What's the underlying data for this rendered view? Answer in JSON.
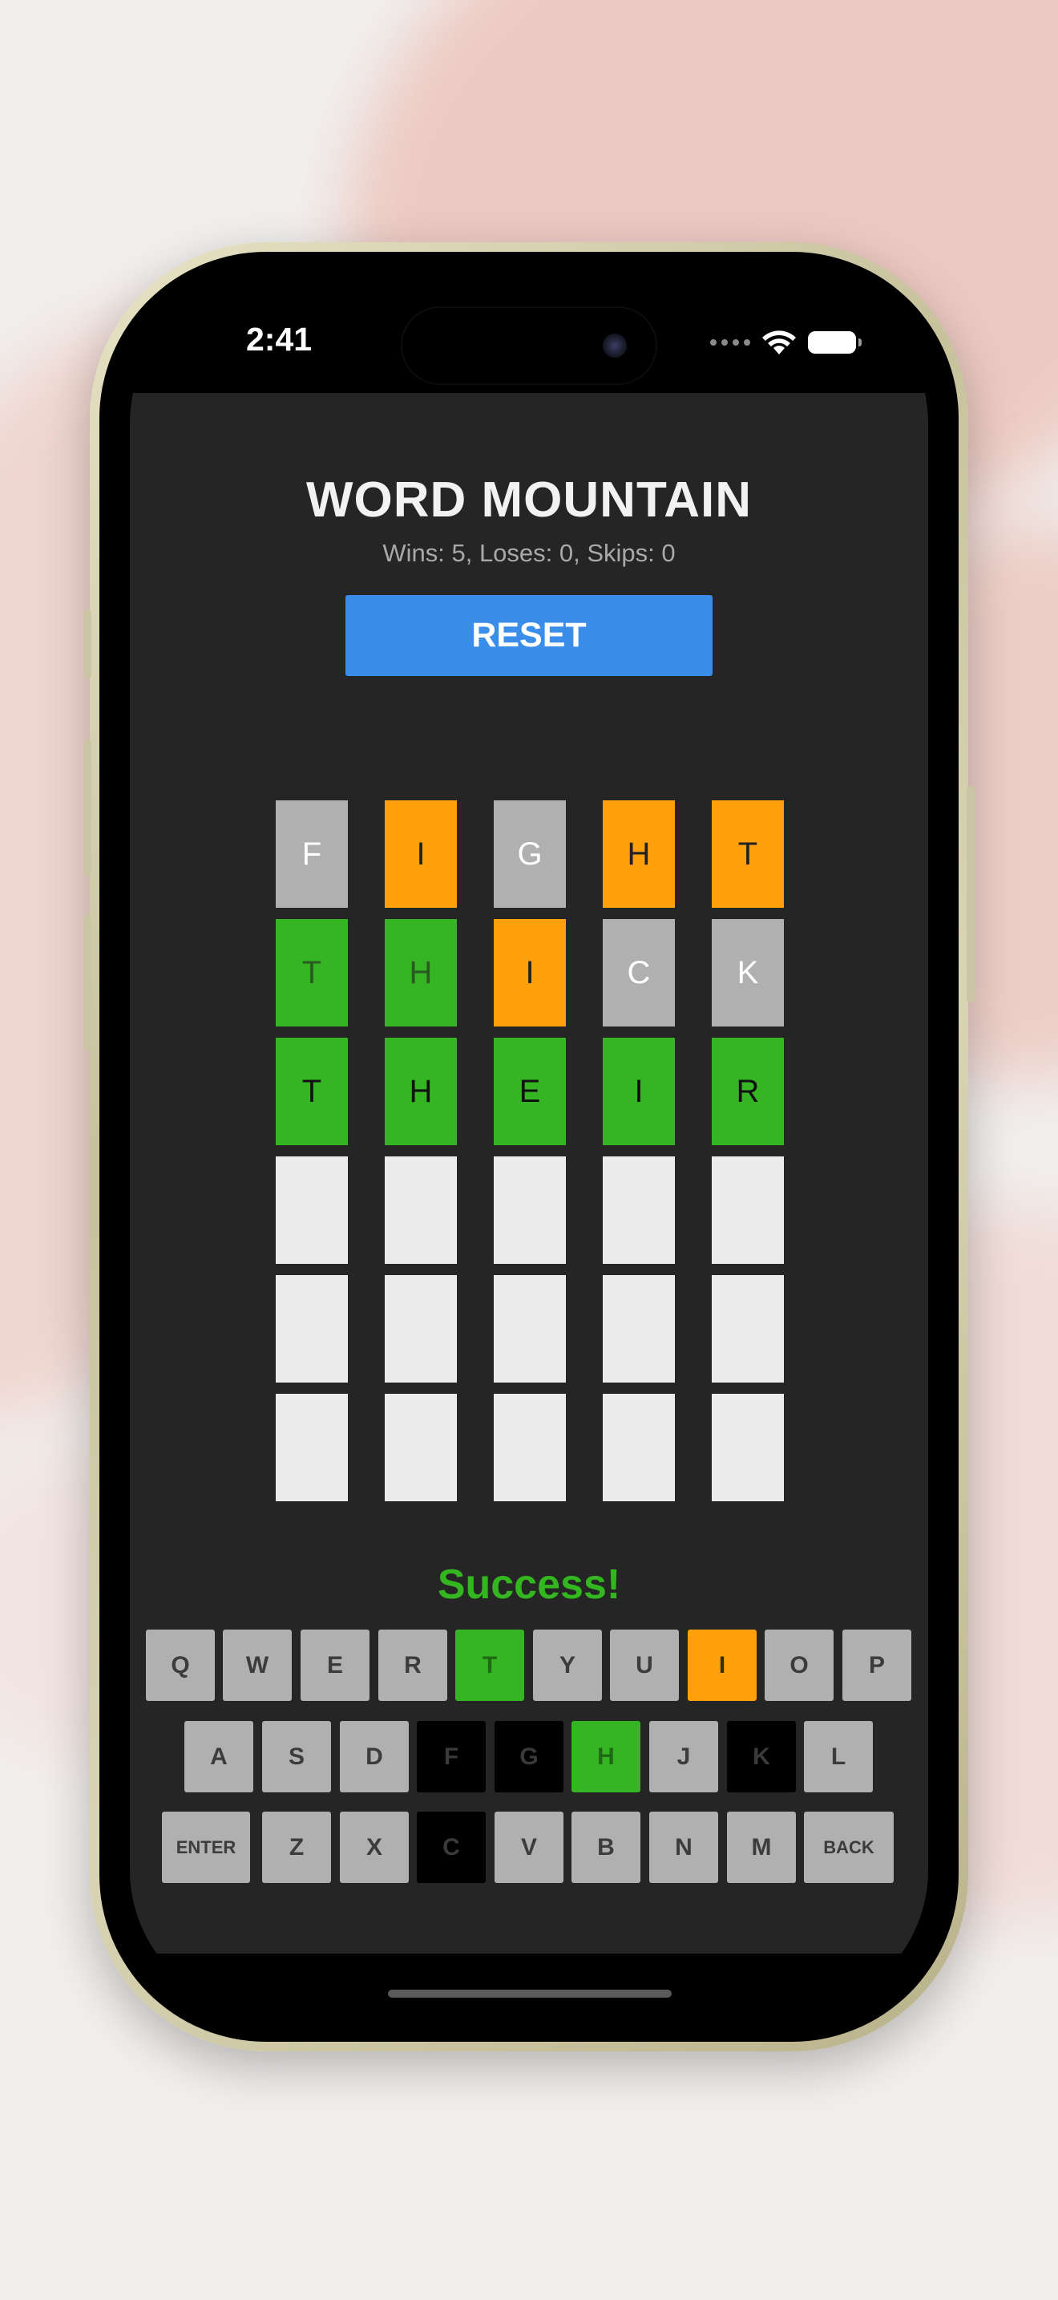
{
  "status_bar": {
    "time": "2:41"
  },
  "app": {
    "title": "WORD MOUNTAIN",
    "stats": "Wins: 5, Loses: 0, Skips: 0",
    "reset_label": "RESET",
    "message": "Success!"
  },
  "colors": {
    "green": "#36b524",
    "orange": "#ffa00c",
    "gray": "#b0b0b0",
    "empty": "#ececec",
    "absent": "#000000",
    "reset": "#3a8de8"
  },
  "board": [
    [
      {
        "letter": "F",
        "state": "gray"
      },
      {
        "letter": "I",
        "state": "orange"
      },
      {
        "letter": "G",
        "state": "gray"
      },
      {
        "letter": "H",
        "state": "orange"
      },
      {
        "letter": "T",
        "state": "orange"
      }
    ],
    [
      {
        "letter": "T",
        "state": "green"
      },
      {
        "letter": "H",
        "state": "green"
      },
      {
        "letter": "I",
        "state": "orange"
      },
      {
        "letter": "C",
        "state": "gray"
      },
      {
        "letter": "K",
        "state": "gray"
      }
    ],
    [
      {
        "letter": "T",
        "state": "green"
      },
      {
        "letter": "H",
        "state": "green"
      },
      {
        "letter": "E",
        "state": "green"
      },
      {
        "letter": "I",
        "state": "green"
      },
      {
        "letter": "R",
        "state": "green"
      }
    ],
    [
      {
        "letter": "",
        "state": "empty"
      },
      {
        "letter": "",
        "state": "empty"
      },
      {
        "letter": "",
        "state": "empty"
      },
      {
        "letter": "",
        "state": "empty"
      },
      {
        "letter": "",
        "state": "empty"
      }
    ],
    [
      {
        "letter": "",
        "state": "empty"
      },
      {
        "letter": "",
        "state": "empty"
      },
      {
        "letter": "",
        "state": "empty"
      },
      {
        "letter": "",
        "state": "empty"
      },
      {
        "letter": "",
        "state": "empty"
      }
    ],
    [
      {
        "letter": "",
        "state": "empty"
      },
      {
        "letter": "",
        "state": "empty"
      },
      {
        "letter": "",
        "state": "empty"
      },
      {
        "letter": "",
        "state": "empty"
      },
      {
        "letter": "",
        "state": "empty"
      }
    ]
  ],
  "keyboard": [
    [
      {
        "label": "Q",
        "state": "gray"
      },
      {
        "label": "W",
        "state": "gray"
      },
      {
        "label": "E",
        "state": "gray"
      },
      {
        "label": "R",
        "state": "gray"
      },
      {
        "label": "T",
        "state": "green"
      },
      {
        "label": "Y",
        "state": "gray"
      },
      {
        "label": "U",
        "state": "gray"
      },
      {
        "label": "I",
        "state": "orange"
      },
      {
        "label": "O",
        "state": "gray"
      },
      {
        "label": "P",
        "state": "gray"
      }
    ],
    [
      {
        "label": "A",
        "state": "gray"
      },
      {
        "label": "S",
        "state": "gray"
      },
      {
        "label": "D",
        "state": "gray"
      },
      {
        "label": "F",
        "state": "absent"
      },
      {
        "label": "G",
        "state": "absent"
      },
      {
        "label": "H",
        "state": "green"
      },
      {
        "label": "J",
        "state": "gray"
      },
      {
        "label": "K",
        "state": "absent"
      },
      {
        "label": "L",
        "state": "gray"
      }
    ],
    [
      {
        "label": "ENTER",
        "state": "gray"
      },
      {
        "label": "Z",
        "state": "gray"
      },
      {
        "label": "X",
        "state": "gray"
      },
      {
        "label": "C",
        "state": "absent"
      },
      {
        "label": "V",
        "state": "gray"
      },
      {
        "label": "B",
        "state": "gray"
      },
      {
        "label": "N",
        "state": "gray"
      },
      {
        "label": "M",
        "state": "gray"
      },
      {
        "label": "BACK",
        "state": "gray"
      }
    ]
  ]
}
